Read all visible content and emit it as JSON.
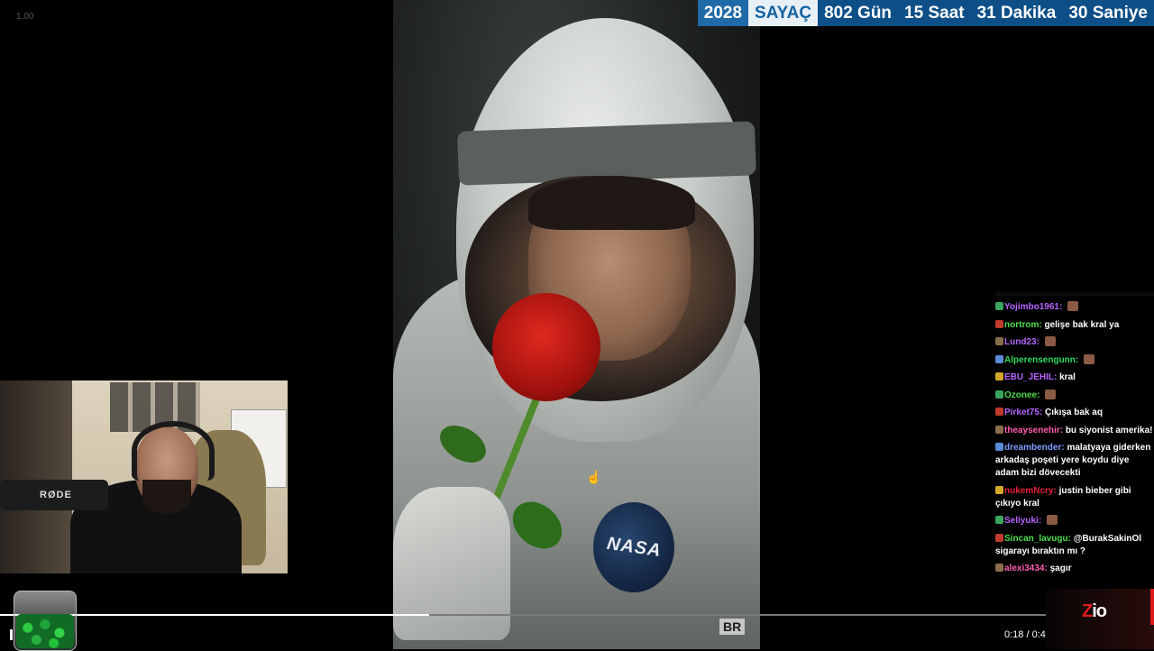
{
  "player": {
    "speed_label": "1.00",
    "time_label": "0:18 / 0:4",
    "progress_fraction": 0.41
  },
  "video": {
    "patch_text": "NASA",
    "corner_text": "BR"
  },
  "counter": {
    "year": "2028",
    "label": "SAYAÇ",
    "days_num": "802",
    "days_unit": "Gün",
    "hours_num": "15",
    "hours_unit": "Saat",
    "minutes_num": "31",
    "minutes_unit": "Dakika",
    "seconds_num": "30",
    "seconds_unit": "Saniye"
  },
  "webcam": {
    "mic_brand": "RØDE"
  },
  "chat": {
    "messages": [
      {
        "user": "Yojimbo1961",
        "text": "",
        "color": "#b565ff"
      },
      {
        "user": "nortrom",
        "text": "gelişe bak kral ya",
        "color": "#4cde4c"
      },
      {
        "user": "Lund23",
        "text": "",
        "color": "#b565ff"
      },
      {
        "user": "Alperensengunn",
        "text": "",
        "color": "#2ddc5f"
      },
      {
        "user": "EBU_JEHIL",
        "text": "kral",
        "color": "#b565ff"
      },
      {
        "user": "Ozonee",
        "text": "",
        "color": "#4cde4c"
      },
      {
        "user": "Pirket75",
        "text": "Çıkışa bak aq",
        "color": "#b565ff"
      },
      {
        "user": "theaysenehir",
        "text": "bu siyonist amerika!",
        "color": "#ff5db1"
      },
      {
        "user": "dreambender",
        "text": "malatyaya giderken arkadaş poşeti yere koydu diye adam bizi dövecekti",
        "color": "#7f9cff"
      },
      {
        "user": "nukemNcry",
        "text": "justin bieber gibi çıkıyo kral",
        "color": "#e8203a"
      },
      {
        "user": "Seliyuki",
        "text": "",
        "color": "#b565ff"
      },
      {
        "user": "Sincan_lavugu",
        "text": "@BurakSakinOl sigarayı bıraktın mı ?",
        "color": "#4cde4c"
      },
      {
        "user": "alexi3434",
        "text": "şagır",
        "color": "#ff5db1"
      }
    ]
  },
  "logo": {
    "z": "Z",
    "rest": "io"
  }
}
